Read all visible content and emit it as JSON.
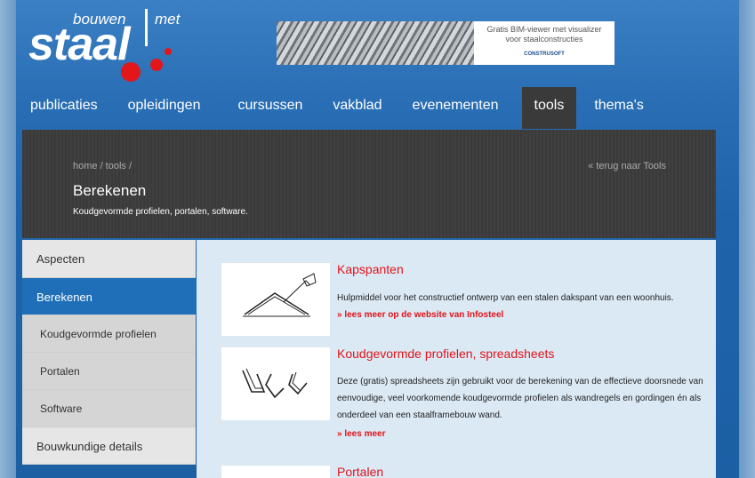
{
  "logo": {
    "bouwen": "bouwen",
    "met": "met",
    "staal": "staal"
  },
  "banner": {
    "line1": "Gratis BIM-viewer met visualizer",
    "line2": "voor staalconstructies",
    "brand": "CONSTRUSOFT"
  },
  "nav": [
    "publicaties",
    "opleidingen",
    "cursussen",
    "vakblad",
    "evenementen",
    "tools",
    "thema's"
  ],
  "header": {
    "breadcrumb": "home / tools /",
    "back": "« terug naar Tools",
    "title": "Berekenen",
    "subtitle": "Koudgevormde profielen, portalen, software."
  },
  "sidebar": [
    {
      "label": "Aspecten"
    },
    {
      "label": "Berekenen"
    },
    {
      "label": "Koudgevormde profielen"
    },
    {
      "label": "Portalen"
    },
    {
      "label": "Software"
    },
    {
      "label": "Bouwkundige details"
    }
  ],
  "items": [
    {
      "title": "Kapspanten",
      "desc": "Hulpmiddel voor het constructief ontwerp van een stalen dakspant van een woonhuis.",
      "more": "» lees meer op de website van Infosteel"
    },
    {
      "title": "Koudgevormde profielen, spreadsheets",
      "desc": "Deze (gratis) spreadsheets zijn gebruikt voor de berekening van de effectieve doorsnede van eenvoudige, veel voorkomende koudgevormde profielen als wandregels en gordingen én als onderdeel van een staalframebouw wand.",
      "more": "» lees meer"
    },
    {
      "title": "Portalen"
    }
  ]
}
